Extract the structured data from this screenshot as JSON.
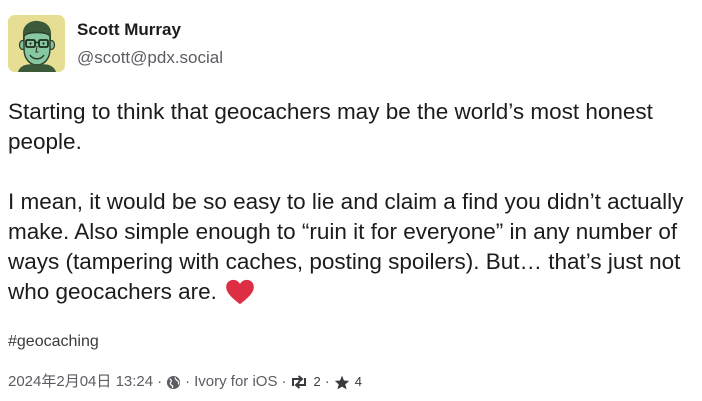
{
  "author": {
    "display_name": "Scott Murray",
    "handle": "@scott@pdx.social",
    "avatar_bg": "#e6df93"
  },
  "post": {
    "paragraphs": [
      "Starting to think that geocachers may be the world’s most honest people.",
      "I mean, it would be so easy to lie and claim a find you didn’t actually make. Also simple enough to “ruin it for everyone” in any number of ways (tampering with caches, posting spoilers). But… that’s just not who geocachers are."
    ],
    "emoji_icon": "red-heart-icon",
    "hashtag": "#geocaching"
  },
  "meta": {
    "timestamp": "2024年2月04日 13:24",
    "separator": "·",
    "visibility_icon": "globe-icon",
    "client": "Ivory for iOS",
    "boost_icon": "boost-icon",
    "boosts": "2",
    "favourite_icon": "star-icon",
    "favourites": "4"
  },
  "colors": {
    "heart": "#dd2e44",
    "text": "#1c1c1e",
    "muted": "#5c5c63"
  }
}
